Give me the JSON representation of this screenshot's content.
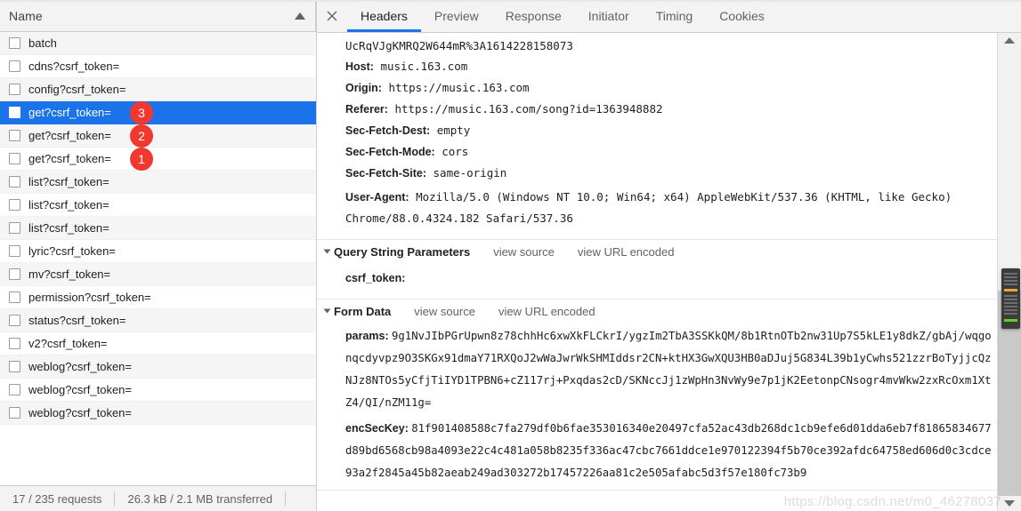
{
  "left_panel": {
    "column_header": "Name",
    "sort_icon": "sort-ascending-arrow",
    "requests": [
      {
        "name": "batch",
        "badge": null,
        "selected": false
      },
      {
        "name": "cdns?csrf_token=",
        "badge": null,
        "selected": false
      },
      {
        "name": "config?csrf_token=",
        "badge": null,
        "selected": false
      },
      {
        "name": "get?csrf_token=",
        "badge": "3",
        "selected": true
      },
      {
        "name": "get?csrf_token=",
        "badge": "2",
        "selected": false
      },
      {
        "name": "get?csrf_token=",
        "badge": "1",
        "selected": false
      },
      {
        "name": "list?csrf_token=",
        "badge": null,
        "selected": false
      },
      {
        "name": "list?csrf_token=",
        "badge": null,
        "selected": false
      },
      {
        "name": "list?csrf_token=",
        "badge": null,
        "selected": false
      },
      {
        "name": "lyric?csrf_token=",
        "badge": null,
        "selected": false
      },
      {
        "name": "mv?csrf_token=",
        "badge": null,
        "selected": false
      },
      {
        "name": "permission?csrf_token=",
        "badge": null,
        "selected": false
      },
      {
        "name": "status?csrf_token=",
        "badge": null,
        "selected": false
      },
      {
        "name": "v2?csrf_token=",
        "badge": null,
        "selected": false
      },
      {
        "name": "weblog?csrf_token=",
        "badge": null,
        "selected": false
      },
      {
        "name": "weblog?csrf_token=",
        "badge": null,
        "selected": false
      },
      {
        "name": "weblog?csrf_token=",
        "badge": null,
        "selected": false
      }
    ],
    "footer": {
      "requests": "17 / 235 requests",
      "transferred": "26.3 kB / 2.1 MB transferred"
    }
  },
  "detail_panel": {
    "close_icon": "close-icon",
    "tabs": [
      {
        "label": "Headers",
        "active": true
      },
      {
        "label": "Preview",
        "active": false
      },
      {
        "label": "Response",
        "active": false
      },
      {
        "label": "Initiator",
        "active": false
      },
      {
        "label": "Timing",
        "active": false
      },
      {
        "label": "Cookies",
        "active": false
      }
    ],
    "headers": [
      {
        "key": "",
        "value": "UcRqVJgKMRQ2W644mR%3A1614228158073"
      },
      {
        "key": "Host:",
        "value": "music.163.com"
      },
      {
        "key": "Origin:",
        "value": "https://music.163.com"
      },
      {
        "key": "Referer:",
        "value": "https://music.163.com/song?id=1363948882"
      },
      {
        "key": "Sec-Fetch-Dest:",
        "value": "empty"
      },
      {
        "key": "Sec-Fetch-Mode:",
        "value": "cors"
      },
      {
        "key": "Sec-Fetch-Site:",
        "value": "same-origin"
      },
      {
        "key": "User-Agent:",
        "value": "Mozilla/5.0 (Windows NT 10.0; Win64; x64) AppleWebKit/537.36 (KHTML, like Gecko) Chrome/88.0.4324.182 Safari/537.36"
      }
    ],
    "query_string_section": {
      "title": "Query String Parameters",
      "view_source": "view source",
      "view_url_encoded": "view URL encoded",
      "params": [
        {
          "key": "csrf_token:",
          "value": ""
        }
      ]
    },
    "form_data_section": {
      "title": "Form Data",
      "view_source": "view source",
      "view_url_encoded": "view URL encoded",
      "params": [
        {
          "key": "params:",
          "value": "9g1NvJIbPGrUpwn8z78chhHc6xwXkFLCkrI/ygzIm2TbA3SSKkQM/8b1RtnOTb2nw31Up7S5kLE1y8dkZ/gbAj/wqgonqcdyvpz9O3SKGx91dmaY71RXQoJ2wWaJwrWkSHMIddsr2CN+ktHX3GwXQU3HB0aDJuj5G834L39b1yCwhs521zzrBoTyjjcQzNJz8NTOs5yCfjTiIYD1TPBN6+cZ117rj+Pxqdas2cD/SKNccJj1zWpHn3NvWy9e7p1jK2EetonpCNsogr4mvWkw2zxRcOxm1XtZ4/QI/nZM11g="
        },
        {
          "key": "encSecKey:",
          "value": "81f901408588c7fa279df0b6fae353016340e20497cfa52ac43db268dc1cb9efe6d01dda6eb7f81865834677d89bd6568cb98a4093e22c4c481a058b8235f336ac47cbc7661ddce1e970122394f5b70ce392afdc64758ed606d0c3cdce93a2f2845a45b82aeab249ad303272b17457226aa81c2e505afabc5d3f57e180fc73b9"
        }
      ]
    },
    "scrollbar": {
      "up_arrow_icon": "scroll-up-arrow-icon",
      "down_arrow_icon": "scroll-down-arrow-icon",
      "thumb_icon": "scrollbar-thumb"
    }
  },
  "watermark": "https://blog.csdn.net/m0_46278037"
}
